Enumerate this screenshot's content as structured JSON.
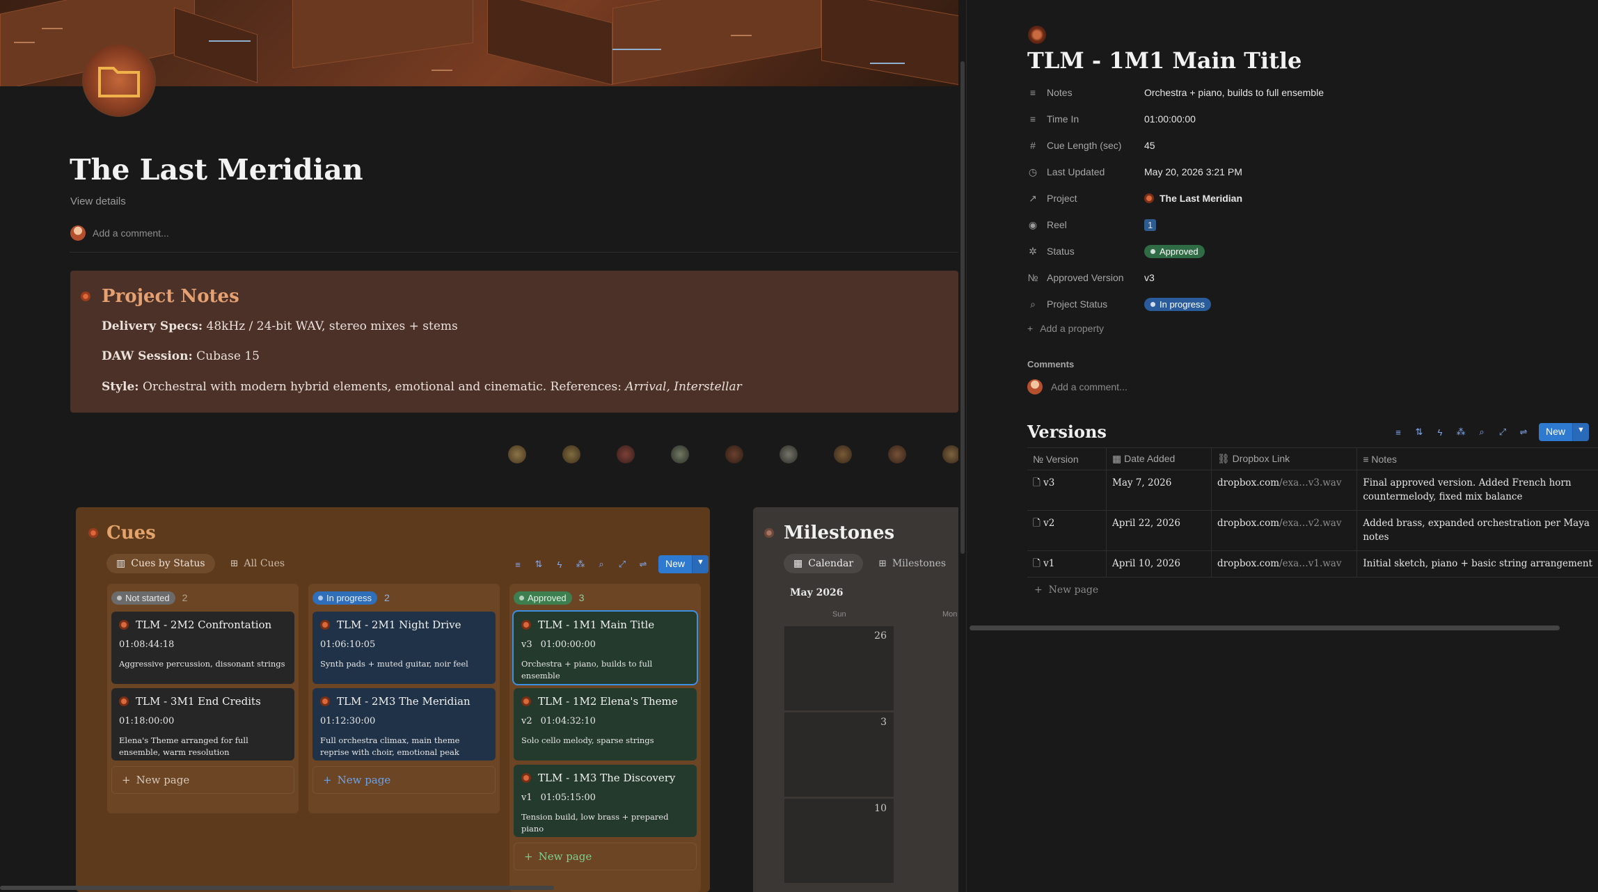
{
  "page": {
    "title": "The Last Meridian",
    "view_details": "View details",
    "add_comment": "Add a comment..."
  },
  "project_notes": {
    "title": "Project Notes",
    "lines": [
      {
        "label": "Delivery Specs:",
        "text": " 48kHz / 24-bit WAV, stereo mixes + stems"
      },
      {
        "label": "DAW Session:",
        "text": " Cubase 15"
      },
      {
        "label": "Style:",
        "text": " Orchestral with modern hybrid elements, emotional and cinematic. References: ",
        "italic": "Arrival, Interstellar"
      }
    ]
  },
  "cues": {
    "title": "Cues",
    "tabs": [
      "Cues by Status",
      "All Cues"
    ],
    "new_label": "New",
    "new_page": "New page",
    "columns": [
      {
        "status": "Not started",
        "count": "2",
        "color": "#6b6b6b",
        "cards": [
          {
            "title": "TLM - 2M2 Confrontation",
            "version": "",
            "time": "01:08:44:18",
            "desc": "Aggressive percussion, dissonant strings"
          },
          {
            "title": "TLM - 3M1 End Credits",
            "version": "",
            "time": "01:18:00:00",
            "desc": "Elena's Theme arranged for full ensemble, warm resolution"
          }
        ]
      },
      {
        "status": "In progress",
        "count": "2",
        "color": "#2f6eb8",
        "cards": [
          {
            "title": "TLM - 2M1 Night Drive",
            "version": "",
            "time": "01:06:10:05",
            "desc": "Synth pads + muted guitar, noir feel"
          },
          {
            "title": "TLM - 2M3 The Meridian",
            "version": "",
            "time": "01:12:30:00",
            "desc": "Full orchestra climax, main theme reprise with choir, emotional peak"
          }
        ]
      },
      {
        "status": "Approved",
        "count": "3",
        "color": "#3d7f4f",
        "cards": [
          {
            "title": "TLM - 1M1 Main Title",
            "version": "v3",
            "time": "01:00:00:00",
            "desc": "Orchestra + piano, builds to full ensemble"
          },
          {
            "title": "TLM - 1M2 Elena's Theme",
            "version": "v2",
            "time": "01:04:32:10",
            "desc": "Solo cello melody, sparse strings"
          },
          {
            "title": "TLM - 1M3 The Discovery",
            "version": "v1",
            "time": "01:05:15:00",
            "desc": "Tension build, low brass + prepared piano"
          }
        ]
      }
    ]
  },
  "milestones": {
    "title": "Milestones",
    "tabs": [
      "Calendar",
      "Milestones"
    ],
    "month": "May 2026",
    "day_headers": [
      "Sun",
      "Mon"
    ],
    "dates": [
      "26",
      "3",
      "10"
    ]
  },
  "detail": {
    "title": "TLM - 1M1 Main Title",
    "properties": [
      {
        "icon": "≡",
        "name": "notes-icon",
        "key": "Notes",
        "value": "Orchestra + piano, builds to full ensemble"
      },
      {
        "icon": "≡",
        "name": "time-in-icon",
        "key": "Time In",
        "value": "01:00:00:00"
      },
      {
        "icon": "#",
        "name": "hash-icon",
        "key": "Cue Length (sec)",
        "value": "45"
      },
      {
        "icon": "◷",
        "name": "clock-icon",
        "key": "Last Updated",
        "value": "May 20, 2026 3:21 PM"
      },
      {
        "icon": "↗",
        "name": "relation-icon",
        "key": "Project",
        "value": "The Last Meridian",
        "type": "relation"
      },
      {
        "icon": "◉",
        "name": "select-icon",
        "key": "Reel",
        "value": "1",
        "type": "tag"
      },
      {
        "icon": "✲",
        "name": "status-icon",
        "key": "Status",
        "value": "Approved",
        "type": "status",
        "color": "#2f6b45"
      },
      {
        "icon": "№",
        "name": "number-icon",
        "key": "Approved Version",
        "value": "v3"
      },
      {
        "icon": "⌕",
        "name": "rollup-icon",
        "key": "Project Status",
        "value": "In progress",
        "type": "status",
        "color": "#2a5c9c"
      }
    ],
    "add_property": "Add a property",
    "comments_label": "Comments",
    "add_comment": "Add a comment..."
  },
  "versions": {
    "title": "Versions",
    "new_label": "New",
    "new_page": "New page",
    "headers": [
      "Version",
      "Date Added",
      "Dropbox Link",
      "Notes"
    ],
    "rows": [
      {
        "version": "v3",
        "date": "May 7, 2026",
        "link_host": "dropbox.com",
        "link_path": "/exa…v3.wav",
        "notes": "Final approved version. Added French horn countermelody, fixed mix balance"
      },
      {
        "version": "v2",
        "date": "April 22, 2026",
        "link_host": "dropbox.com",
        "link_path": "/exa…v2.wav",
        "notes": "Added brass, expanded orchestration per Maya notes"
      },
      {
        "version": "v1",
        "date": "April 10, 2026",
        "link_host": "dropbox.com",
        "link_path": "/exa…v1.wav",
        "notes": "Initial sketch, piano + basic string arrangement"
      }
    ]
  },
  "colors": {
    "accent": "#2e7ad1",
    "cues_bg": "#5d3a1c",
    "notes_bg": "#4b3127"
  }
}
